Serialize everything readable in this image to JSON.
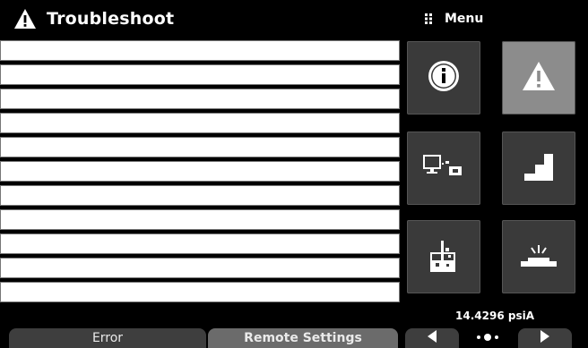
{
  "header": {
    "title": "Troubleshoot"
  },
  "menu": {
    "label": "Menu"
  },
  "list": {
    "rows": [
      "",
      "",
      "",
      "",
      "",
      "",
      "",
      "",
      "",
      "",
      "",
      ""
    ]
  },
  "status": {
    "pressure": "14.4296 psiA"
  },
  "bottom": {
    "error_label": "Error",
    "remote_label": "Remote Settings"
  },
  "tiles": [
    {
      "name": "info",
      "icon": "info-icon",
      "active": false
    },
    {
      "name": "troubleshoot",
      "icon": "warning-icon",
      "active": true
    },
    {
      "name": "remote",
      "icon": "remote-devices-icon",
      "active": false
    },
    {
      "name": "steps",
      "icon": "step-chart-icon",
      "active": false
    },
    {
      "name": "measurement",
      "icon": "lab-beaker-icon",
      "active": false
    },
    {
      "name": "display",
      "icon": "display-light-icon",
      "active": false
    }
  ],
  "colors": {
    "background": "#000000",
    "tile": "#3a3a3a",
    "tile_active": "#8c8c8c",
    "button": "#5a5a5a"
  }
}
